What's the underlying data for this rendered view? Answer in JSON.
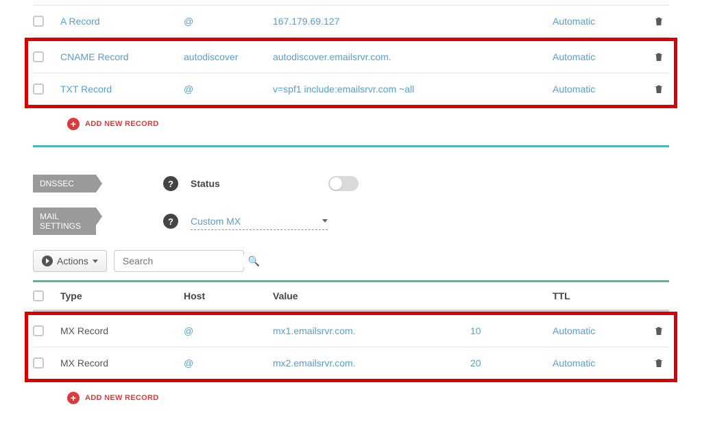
{
  "records_top": [
    {
      "type": "A Record",
      "host": "@",
      "value": "167.179.69.127",
      "ttl": "Automatic"
    },
    {
      "type": "CNAME Record",
      "host": "autodiscover",
      "value": "autodiscover.emailsrvr.com.",
      "ttl": "Automatic"
    },
    {
      "type": "TXT Record",
      "host": "@",
      "value": "v=spf1 include:emailsrvr.com ~all",
      "ttl": "Automatic"
    }
  ],
  "add_new_label": "ADD NEW RECORD",
  "dnssec": {
    "tag": "DNSSEC",
    "help": "?",
    "status_label": "Status"
  },
  "mail": {
    "tag": "MAIL SETTINGS",
    "help": "?",
    "selected": "Custom MX"
  },
  "actions_label": "Actions",
  "search_placeholder": "Search",
  "mx_headers": {
    "type": "Type",
    "host": "Host",
    "value": "Value",
    "ttl": "TTL"
  },
  "mx_records": [
    {
      "type": "MX Record",
      "host": "@",
      "value": "mx1.emailsrvr.com.",
      "priority": "10",
      "ttl": "Automatic"
    },
    {
      "type": "MX Record",
      "host": "@",
      "value": "mx2.emailsrvr.com.",
      "priority": "20",
      "ttl": "Automatic"
    }
  ]
}
